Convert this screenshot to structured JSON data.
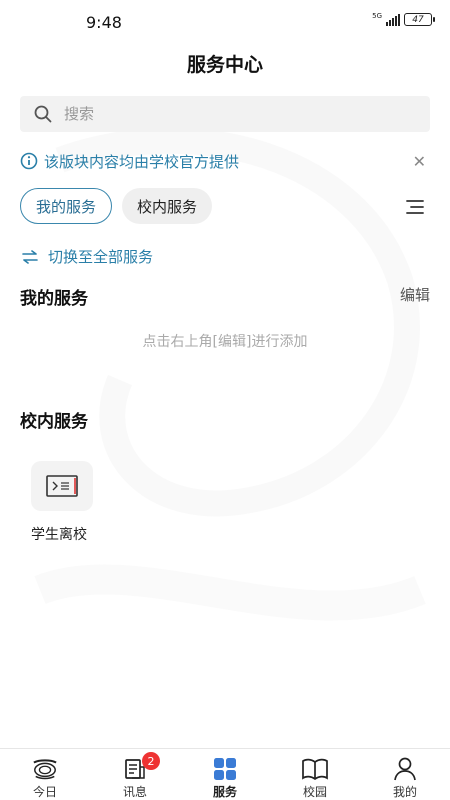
{
  "status_bar": {
    "time": "9:48",
    "network": "5G",
    "battery": "47"
  },
  "header": {
    "title": "服务中心"
  },
  "search": {
    "placeholder": "搜索"
  },
  "notice": {
    "text": "该版块内容均由学校官方提供",
    "close_icon": "close-icon"
  },
  "tabs": [
    {
      "label": "我的服务",
      "active": true
    },
    {
      "label": "校内服务",
      "active": false
    }
  ],
  "switch_link": {
    "label": "切换至全部服务"
  },
  "my_services": {
    "title": "我的服务",
    "edit_label": "编辑",
    "empty_hint": "点击右上角[编辑]进行添加"
  },
  "campus_services": {
    "title": "校内服务",
    "items": [
      {
        "label": "学生离校",
        "icon": "terminal-icon"
      }
    ]
  },
  "colors": {
    "accent": "#2a7fa8",
    "badge": "#e33333",
    "nav_active": "#3a7bd5"
  },
  "bottom_nav": [
    {
      "label": "今日",
      "icon": "today-logo-icon"
    },
    {
      "label": "讯息",
      "icon": "message-icon",
      "badge": "2"
    },
    {
      "label": "服务",
      "icon": "grid-icon",
      "active": true
    },
    {
      "label": "校园",
      "icon": "book-icon"
    },
    {
      "label": "我的",
      "icon": "person-icon"
    }
  ]
}
